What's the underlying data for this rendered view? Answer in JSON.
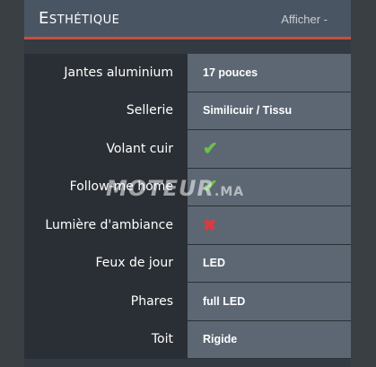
{
  "header": {
    "title": "Esthétique",
    "toggle_label": "Afficher  -"
  },
  "rows": [
    {
      "label": "Jantes aluminium",
      "value": "17 pouces"
    },
    {
      "label": "Sellerie",
      "value": "Similicuir / Tissu"
    },
    {
      "label": "Volant cuir",
      "value": "✔"
    },
    {
      "label": "Follow-me home",
      "value": "✔"
    },
    {
      "label": "Lumière d'ambiance",
      "value": "✖"
    },
    {
      "label": "Feux de jour",
      "value": "LED"
    },
    {
      "label": "Phares",
      "value": "full LED"
    },
    {
      "label": "Toit",
      "value": "Rigide"
    }
  ],
  "watermark": {
    "text": "MOTEUR",
    "tld": ".MA"
  },
  "colors": {
    "accent": "#c94f3b",
    "check": "#6cc04a",
    "cross": "#e0383e"
  }
}
